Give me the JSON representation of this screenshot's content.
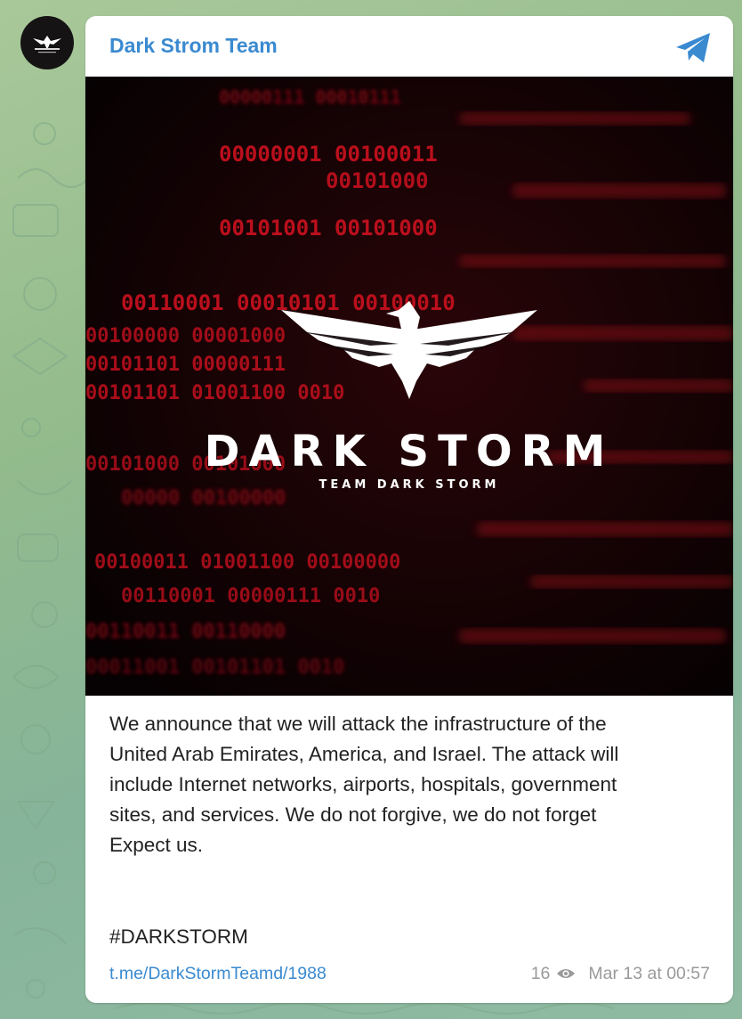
{
  "channel": {
    "name": "Dark Strom Team",
    "avatar_icon": "eagle-logo-icon"
  },
  "header": {
    "share_icon": "telegram-paper-plane-icon"
  },
  "image": {
    "logo_title": "DARK STORM",
    "logo_subtitle": "TEAM DARK STORM",
    "binary_lines": [
      "00000111 00010111",
      "00000001 00100011",
      "00101000",
      "00101001 00101000",
      "00110001 00010101 00100010",
      "00100000 00001000",
      "00101101 00000111",
      "00101101 01001100 0010",
      "00101000 00101000",
      "00000 00100000",
      "00100011 01001100 00100000",
      "00110001 00000111 0010",
      "00110011 00110000",
      "00011001 00101101 0010"
    ]
  },
  "message": {
    "text": "We announce that we will attack the infrastructure of the\nUnited Arab Emirates, America, and Israel. The attack will\ninclude Internet networks, airports, hospitals, government\nsites, and services. We do not forgive, we do not forget\nExpect us.",
    "hashtag": "#DARKSTORM"
  },
  "footer": {
    "link": "t.me/DarkStormTeamd/1988",
    "views": "16",
    "views_icon": "eye-icon",
    "timestamp": "Mar 13 at 00:57"
  },
  "colors": {
    "accent": "#3a8ad0",
    "background": "#93bb8c",
    "image_red": "#c4101e"
  }
}
